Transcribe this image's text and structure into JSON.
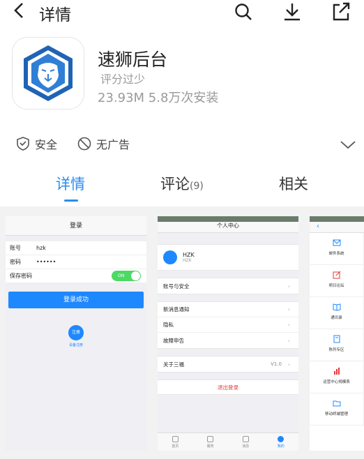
{
  "header": {
    "title": "详情"
  },
  "app": {
    "name": "速狮后台",
    "rating": "评分过少",
    "stats": "23.93M  5.8万次安装"
  },
  "badges": {
    "safe": "安全",
    "no_ads": "无广告"
  },
  "tabs": {
    "details": "详情",
    "comments": "评论",
    "comments_count": "(9)",
    "related": "相关"
  },
  "colors": {
    "accent": "#2a8cf0",
    "ios_blue": "#1e88ff",
    "toggle_green": "#4cd964",
    "logout_red": "#e53935"
  },
  "shot1": {
    "title": "登录",
    "account_label": "账号",
    "account_value": "hzk",
    "password_label": "密码",
    "password_value": "••••••",
    "remember_label": "保存密码",
    "toggle_text": "ON",
    "login_button": "登录成功",
    "register_button": "注册",
    "register_sub": "设备注册"
  },
  "shot2": {
    "title": "个人中心",
    "user_name": "HZK",
    "user_sub": "HZK",
    "account_security": "账号与安全",
    "new_message": "新消息通知",
    "privacy": "隐私",
    "fault_report": "故障申告",
    "about": "关于三福",
    "version": "V1.0",
    "logout": "退出登录",
    "tabbar": [
      "首页",
      "服务",
      "消息",
      "我的"
    ]
  },
  "shot3": {
    "items": [
      "邮件系统",
      "明日论坛",
      "通讯录",
      "陈列专区",
      "运营中心规模表",
      "移动终端管理"
    ]
  }
}
